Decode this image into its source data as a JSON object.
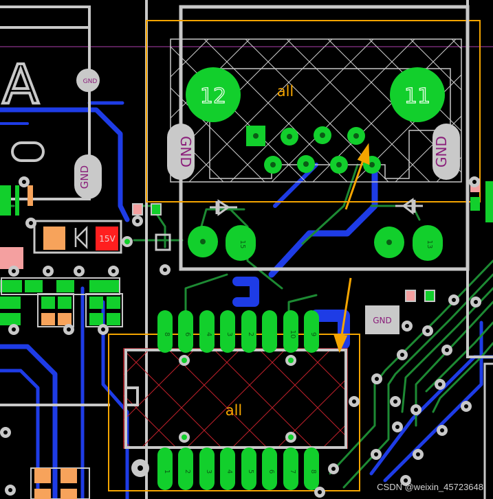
{
  "board": {
    "background": "#000000",
    "colors": {
      "silkscreen": "#c8c8c8",
      "bottom_copper": "#1e3ce6",
      "top_copper": "#1d8a33",
      "pad": "#12cf2c",
      "highlight": "#f5a500",
      "gnd_pad": "#c9c9c9",
      "gnd_text": "#8a1e7a",
      "red_pad": "#ff1f1f",
      "orange_pad": "#f7a35b",
      "pink_pad": "#f4a0a0"
    }
  },
  "connector_top": {
    "label": "all",
    "mount_left": "12",
    "mount_right": "11",
    "gnd_left": "GND",
    "gnd_right": "GND"
  },
  "connector_bottom": {
    "label": "all",
    "pin_numbers_top": [
      "8",
      "6",
      "4",
      "3",
      "2",
      "",
      "10",
      "9"
    ],
    "pin_numbers_bottom": [
      "1",
      "2",
      "3",
      "4",
      "5",
      "6",
      "7",
      "8"
    ]
  },
  "labels": {
    "gnd_a": "GND",
    "gnd_b": "GND",
    "gnd_c": "GND",
    "voltage": "15V",
    "letter": "A",
    "pad_right_1": "15",
    "pad_right_2": "13"
  },
  "icons": [
    "arrow-up-right-icon",
    "arrow-down-icon",
    "diode-icon"
  ],
  "watermark": "CSDN @weixin_45723648"
}
